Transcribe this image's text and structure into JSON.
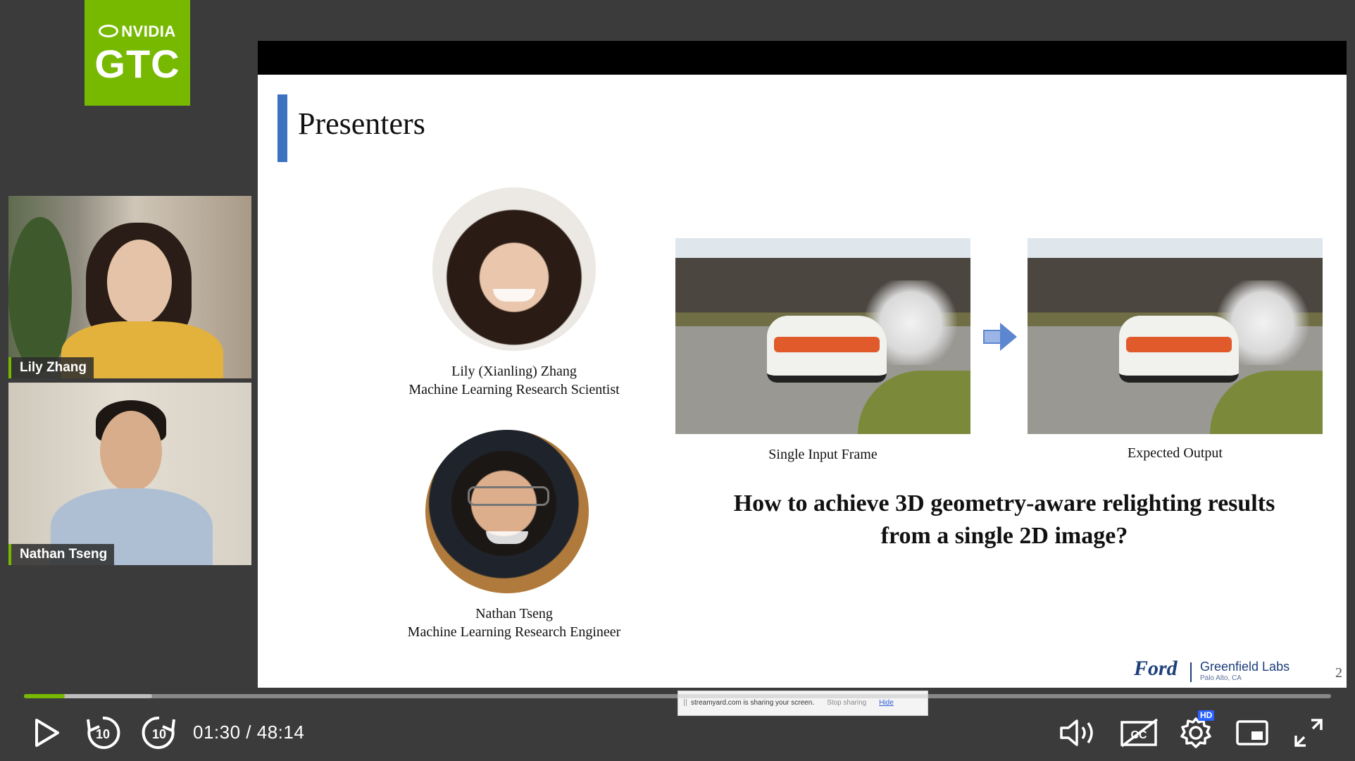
{
  "logo": {
    "brand": "NVIDIA",
    "event": "GTC"
  },
  "participants": [
    {
      "name": "Lily Zhang"
    },
    {
      "name": "Nathan Tseng"
    }
  ],
  "slide": {
    "title": "Presenters",
    "presenters": [
      {
        "name": "Lily (Xianling) Zhang",
        "role": "Machine Learning Research Scientist"
      },
      {
        "name": "Nathan Tseng",
        "role": "Machine Learning Research Engineer"
      }
    ],
    "images": [
      {
        "caption": "Single Input Frame"
      },
      {
        "caption": "Expected Output"
      }
    ],
    "question_line1": "How to achieve 3D geometry-aware relighting results",
    "question_line2": "from a single 2D image?",
    "footer": {
      "logo1": "Ford",
      "logo2": "Greenfield Labs",
      "location": "Palo Alto, CA"
    },
    "page_number": "2"
  },
  "share_banner": {
    "message": "streamyard.com is sharing your screen.",
    "stop": "Stop sharing",
    "hide": "Hide"
  },
  "player": {
    "time_current": "01:30",
    "time_separator": " / ",
    "time_total": "48:14",
    "progress_fraction": 0.031,
    "buffer_fraction": 0.098,
    "hd_badge": "HD",
    "accent_color": "#76b900"
  },
  "icons": [
    "play-icon",
    "rewind-10-icon",
    "forward-10-icon",
    "volume-icon",
    "captions-off-icon",
    "settings-icon",
    "picture-in-picture-icon",
    "fullscreen-icon"
  ]
}
